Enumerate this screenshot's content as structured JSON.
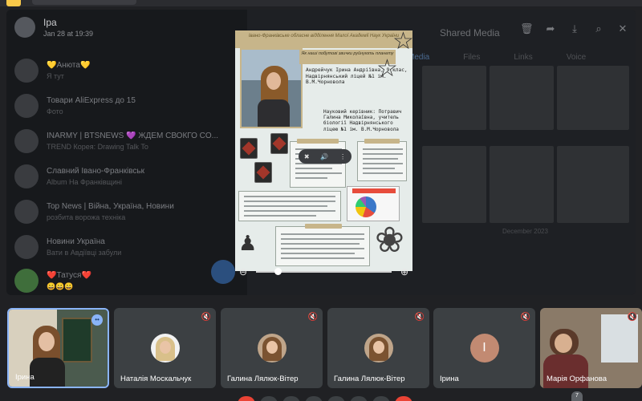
{
  "telegram": {
    "header": {
      "name": "Ipa",
      "date": "Jan 28 at 19:39"
    },
    "chats": [
      {
        "title": "💛Анюта💛",
        "subtitle": "Я тут"
      },
      {
        "title": "Товари AliExpress до 15",
        "subtitle": "Фото"
      },
      {
        "title": "INARMY | BTSNEWS 💜 ЖДЕМ СВОКГО CO...",
        "subtitle": "TREND Корея: Drawing Talk To"
      },
      {
        "title": "Славний Івано-Франківськ",
        "subtitle": "Album На Франківщині"
      },
      {
        "title": "Top News | Війна, Україна, Новини",
        "subtitle": "розбита ворожа техніка"
      },
      {
        "title": "Новини Україна",
        "subtitle": "Вати в Авдіївці забули"
      },
      {
        "title": "❤️Татуся❤️",
        "subtitle": "😀😀😀"
      }
    ],
    "media": {
      "title": "Shared Media",
      "tabs": [
        "Media",
        "Files",
        "Links",
        "Voice"
      ],
      "caption": "December 2023"
    },
    "icons": [
      "trash-icon",
      "share-icon",
      "download-icon",
      "search-icon",
      "close-icon"
    ]
  },
  "poster": {
    "header": "Івано-Франківське обласне відділення Малої Академії Наук України",
    "subtitle": "Як наші побутові звички руйнують планету",
    "author": "Андрейчук Ірина Андріївна, 9 клас, Надвірнянський ліцей №1 ім. В.М.Чорновола",
    "advisor": "Науковий керівник: Потравич Галина Миколаївна, учитель біології Надвірнянського ліцею №1 ім. В.М.Чорновола"
  },
  "zoom": {
    "level": 0.16
  },
  "participants": [
    {
      "name": "Ірина",
      "kind": "video",
      "speaking": true
    },
    {
      "name": "Наталія Москальчук",
      "kind": "avatar",
      "muted": true
    },
    {
      "name": "Галина Лялюк-Вітер",
      "kind": "avatar",
      "muted": true
    },
    {
      "name": "Галина Лялюк-Вітер",
      "kind": "avatar",
      "muted": true
    },
    {
      "name": "Ірина",
      "kind": "initial",
      "initial": "I",
      "muted": true
    },
    {
      "name": "Марія Орфанова",
      "kind": "video",
      "muted": true
    }
  ],
  "participant_count": "7",
  "colors": {
    "accent": "#8ab4f8",
    "tile": "#3c4043",
    "background": "#202124",
    "poster_gold": "#c7b58a"
  }
}
